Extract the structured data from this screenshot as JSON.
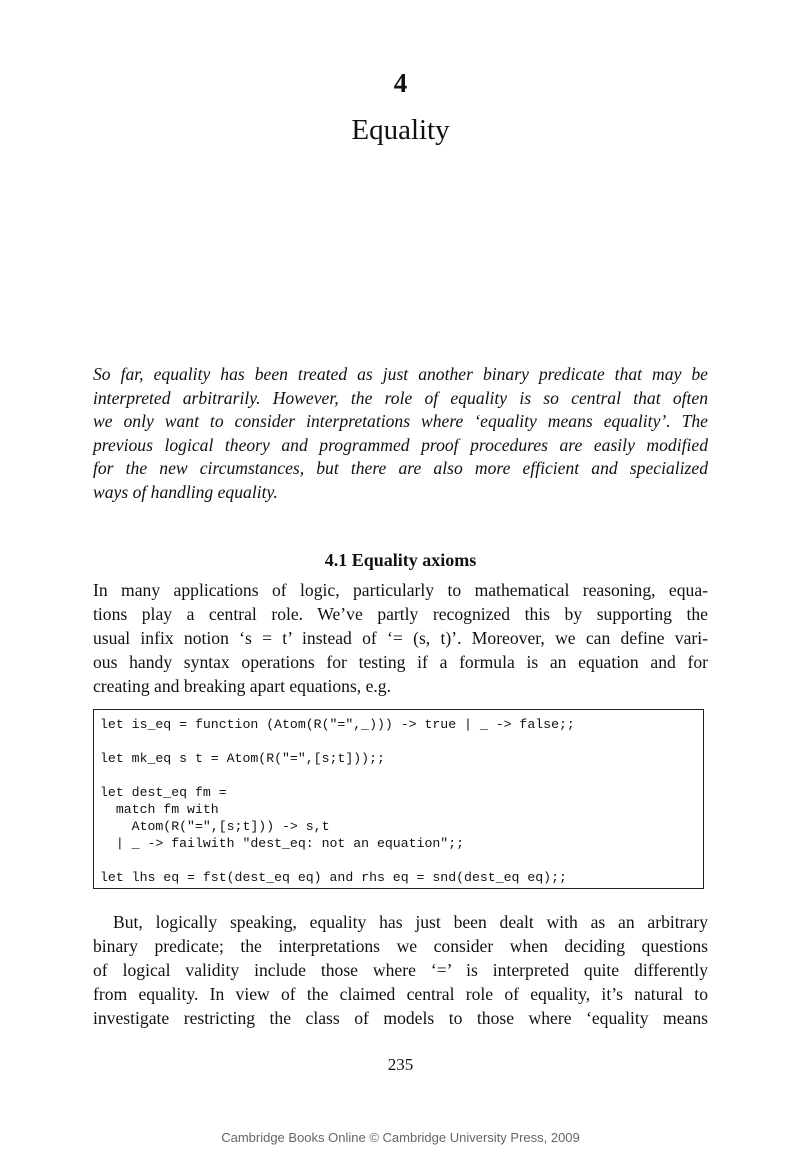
{
  "chapter": {
    "number": "4",
    "title": "Equality"
  },
  "abstract_lines": [
    "So far, equality has been treated as just another binary predicate that may be",
    "interpreted arbitrarily. However, the role of equality is so central that often",
    "we only want to consider interpretations where ‘equality means equality’. The",
    "previous logical theory and programmed proof procedures are easily modified",
    "for the new circumstances, but there are also more efficient and specialized",
    "ways of handling equality."
  ],
  "section": {
    "heading": "4.1  Equality axioms"
  },
  "paragraph1_lines": [
    "In many applications of logic, particularly to mathematical reasoning, equa-",
    "tions play a central role. We’ve partly recognized this by supporting the",
    "usual infix notion ‘s = t’ instead of ‘= (s, t)’. Moreover, we can define vari-",
    "ous handy syntax operations for testing if a formula is an equation and for",
    "creating and breaking apart equations, e.g."
  ],
  "code_lines": [
    "let is_eq = function (Atom(R(\"=\",_))) -> true | _ -> false;;",
    "",
    "let mk_eq s t = Atom(R(\"=\",[s;t]));;",
    "",
    "let dest_eq fm =",
    "  match fm with",
    "    Atom(R(\"=\",[s;t])) -> s,t",
    "  | _ -> failwith \"dest_eq: not an equation\";;",
    "",
    "let lhs eq = fst(dest_eq eq) and rhs eq = snd(dest_eq eq);;"
  ],
  "paragraph2_lines": [
    "But, logically speaking, equality has just been dealt with as an arbitrary",
    "binary predicate; the interpretations we consider when deciding questions",
    "of logical validity include those where ‘=’ is interpreted quite differently",
    "from equality. In view of the claimed central role of equality, it’s natural to",
    "investigate restricting the class of models to those where ‘equality means"
  ],
  "page_number": "235",
  "footer": "Cambridge Books Online © Cambridge University Press, 2009"
}
